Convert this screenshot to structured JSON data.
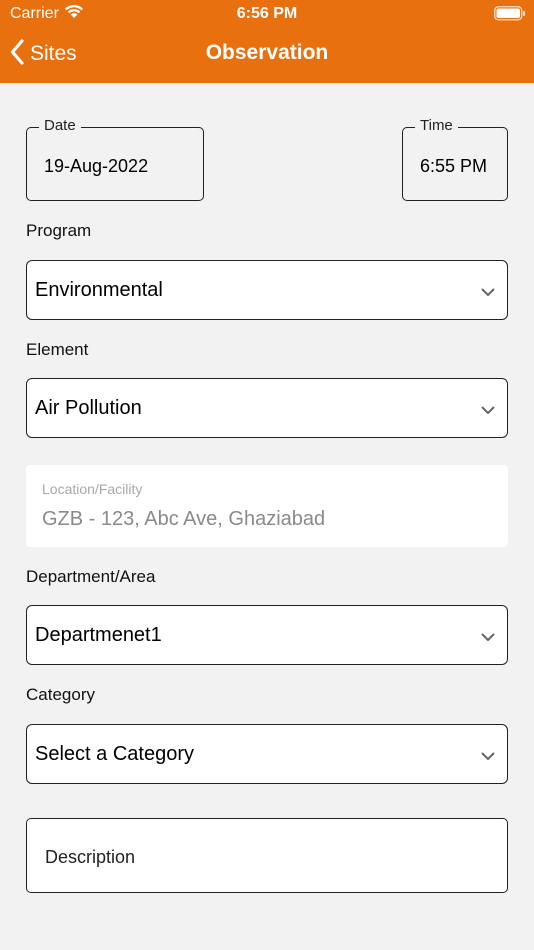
{
  "status_bar": {
    "carrier": "Carrier",
    "time": "6:56 PM"
  },
  "nav": {
    "back_label": "Sites",
    "title": "Observation"
  },
  "date_field": {
    "legend": "Date",
    "value": "19-Aug-2022"
  },
  "time_field": {
    "legend": "Time",
    "value": "6:55 PM"
  },
  "program": {
    "label": "Program",
    "value": "Environmental"
  },
  "element": {
    "label": "Element",
    "value": "Air Pollution"
  },
  "location": {
    "placeholder": "Location/Facility",
    "value": "GZB - 123, Abc Ave, Ghaziabad"
  },
  "department": {
    "label": "Department/Area",
    "value": "Departmenet1"
  },
  "category": {
    "label": "Category",
    "value": "Select a Category"
  },
  "description": {
    "placeholder": "Description"
  },
  "colors": {
    "accent": "#e8700e",
    "background": "#f2f2f2"
  }
}
